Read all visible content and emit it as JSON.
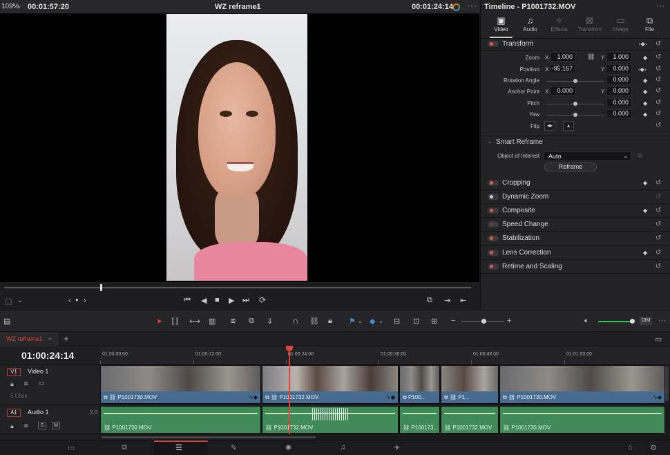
{
  "viewer": {
    "zoom": "109%",
    "source_timecode": "00:01:57:20",
    "timeline_name": "WZ reframe1",
    "record_timecode": "00:01:24:14"
  },
  "inspector": {
    "title": "Timeline - P1001732.MOV",
    "tabs": [
      {
        "label": "Video",
        "active": true
      },
      {
        "label": "Audio",
        "active": false
      },
      {
        "label": "Effects",
        "active": false
      },
      {
        "label": "Transition",
        "active": false
      },
      {
        "label": "Image",
        "active": false
      },
      {
        "label": "File",
        "active": false
      }
    ],
    "transform": {
      "label": "Transform",
      "zoom_label": "Zoom",
      "zoom_x": "1.000",
      "zoom_y": "1.000",
      "position_label": "Position",
      "position_x": "-95.167",
      "position_y": "0.000",
      "rotation_label": "Rotation Angle",
      "rotation": "0.000",
      "anchor_label": "Anchor Point",
      "anchor_x": "0.000",
      "anchor_y": "0.000",
      "pitch_label": "Pitch",
      "pitch": "0.000",
      "yaw_label": "Yaw",
      "yaw": "0.000",
      "flip_label": "Flip",
      "axis_x": "X",
      "axis_y": "Y"
    },
    "smart_reframe": {
      "label": "Smart Reframe",
      "object_label": "Object of Interest",
      "object_value": "Auto",
      "button": "Reframe"
    },
    "sections": [
      {
        "label": "Cropping",
        "state": "on"
      },
      {
        "label": "Dynamic Zoom",
        "state": "off"
      },
      {
        "label": "Composite",
        "state": "on"
      },
      {
        "label": "Speed Change",
        "state": "dim"
      },
      {
        "label": "Stabilization",
        "state": "on"
      },
      {
        "label": "Lens Correction",
        "state": "on"
      },
      {
        "label": "Retime and Scaling",
        "state": "on"
      }
    ]
  },
  "toolbar": {
    "dim_label": "DIM",
    "volume_level": 0.9
  },
  "timeline": {
    "tab_label": "WZ reframe1",
    "timecode": "01:00:24:14",
    "ruler": [
      "01:00:00:00",
      "01:00:12:00",
      "01:00:24:00",
      "01:00:36:00",
      "01:00:48:00",
      "01:01:00:00"
    ],
    "video_track": {
      "badge": "V1",
      "name": "Video 1",
      "clip_count": "5 Clips"
    },
    "audio_track": {
      "badge": "A1",
      "name": "Audio 1",
      "level": "2.0",
      "solo": "S",
      "mute": "M"
    },
    "video_clips": [
      "P1001730.MOV",
      "P1001732.MOV",
      "P100...",
      "P1...",
      "P1001730.MOV"
    ],
    "audio_clips": [
      "P1001730.MOV",
      "P1001732.MOV",
      "P100173...",
      "P1001732.MOV",
      "P1001730.MOV"
    ]
  }
}
